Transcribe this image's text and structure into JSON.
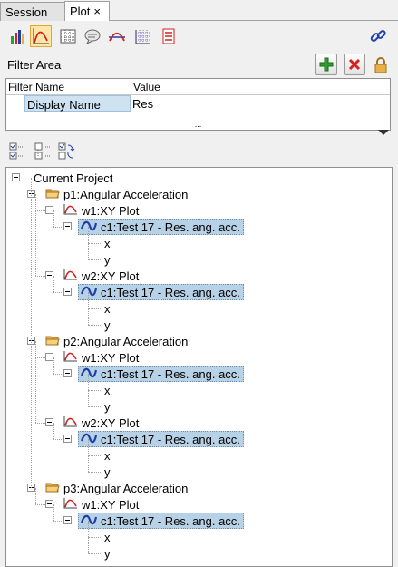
{
  "tabs": [
    {
      "label": "Session"
    },
    {
      "label": "Plot",
      "close": "×"
    }
  ],
  "filter": {
    "label": "Filter Area",
    "columns": [
      "Filter Name",
      "Value"
    ],
    "rows": [
      {
        "name": "Display Name",
        "value": "Res"
      }
    ],
    "more": "..."
  },
  "tree": {
    "root": "Current Project",
    "pages": [
      {
        "label": "p1:Angular Acceleration",
        "windows": [
          {
            "label": "w1:XY Plot",
            "curve": "c1:Test 17 - Res. ang. acc.",
            "children": [
              "x",
              "y"
            ]
          },
          {
            "label": "w2:XY Plot",
            "curve": "c1:Test 17 - Res. ang. acc.",
            "children": [
              "x",
              "y"
            ]
          }
        ]
      },
      {
        "label": "p2:Angular Acceleration",
        "windows": [
          {
            "label": "w1:XY Plot",
            "curve": "c1:Test 17 - Res. ang. acc.",
            "children": [
              "x",
              "y"
            ]
          },
          {
            "label": "w2:XY Plot",
            "curve": "c1:Test 17 - Res. ang. acc.",
            "children": [
              "x",
              "y"
            ]
          }
        ]
      },
      {
        "label": "p3:Angular Acceleration",
        "windows": [
          {
            "label": "w1:XY Plot",
            "curve": "c1:Test 17 - Res. ang. acc.",
            "children": [
              "x",
              "y"
            ]
          }
        ]
      }
    ]
  },
  "colors": {
    "selection": "#b7d1e6",
    "curve": "#1f3fa8",
    "plot_icon": "#d32020",
    "folder": "#e8b04a",
    "add": "#2e9e2e",
    "delete": "#d82020"
  }
}
